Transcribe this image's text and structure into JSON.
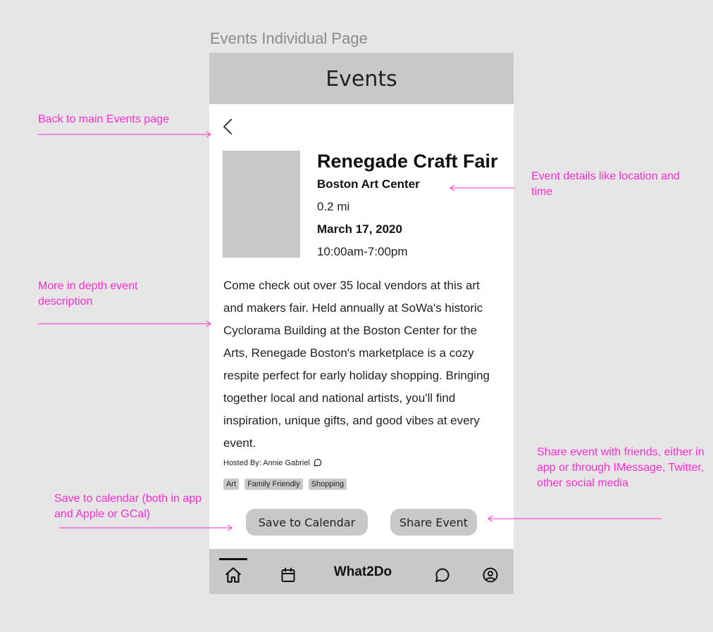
{
  "page_label": "Events Individual Page",
  "header": {
    "title": "Events"
  },
  "event": {
    "name": "Renegade Craft Fair",
    "venue": "Boston Art Center",
    "distance": "0.2 mi",
    "date": "March 17, 2020",
    "time": "10:00am-7:00pm",
    "description": "Come check out over 35 local vendors at this art and makers fair. Held annually at SoWa's historic Cyclorama Building at the Boston Center for the Arts, Renegade Boston's marketplace is a cozy respite perfect for early holiday shopping. Bringing together local and national artists, you'll find inspiration, unique gifts, and good vibes at every event.",
    "hosted_by": "Hosted By: Annie Gabriel",
    "tags": [
      "Art",
      "Family Friendly",
      "Shopping"
    ]
  },
  "actions": {
    "save_label": "Save to Calendar",
    "share_label": "Share Event"
  },
  "nav": {
    "brand": "What2Do",
    "items": [
      "home-icon",
      "calendar-icon",
      "chat-icon",
      "profile-icon"
    ],
    "active": "home-icon"
  },
  "annotations": {
    "back": "Back to main Events page",
    "details": "Event details like location and time",
    "description": "More in depth event description",
    "share": "Share event with friends, either in app or through IMessage, Twitter, other social media",
    "save": "Save to calendar (both in app and Apple or GCal)"
  },
  "colors": {
    "background": "#e6e6e6",
    "panel_gray": "#c8c8c8",
    "annotation": "#ff2bd2"
  }
}
